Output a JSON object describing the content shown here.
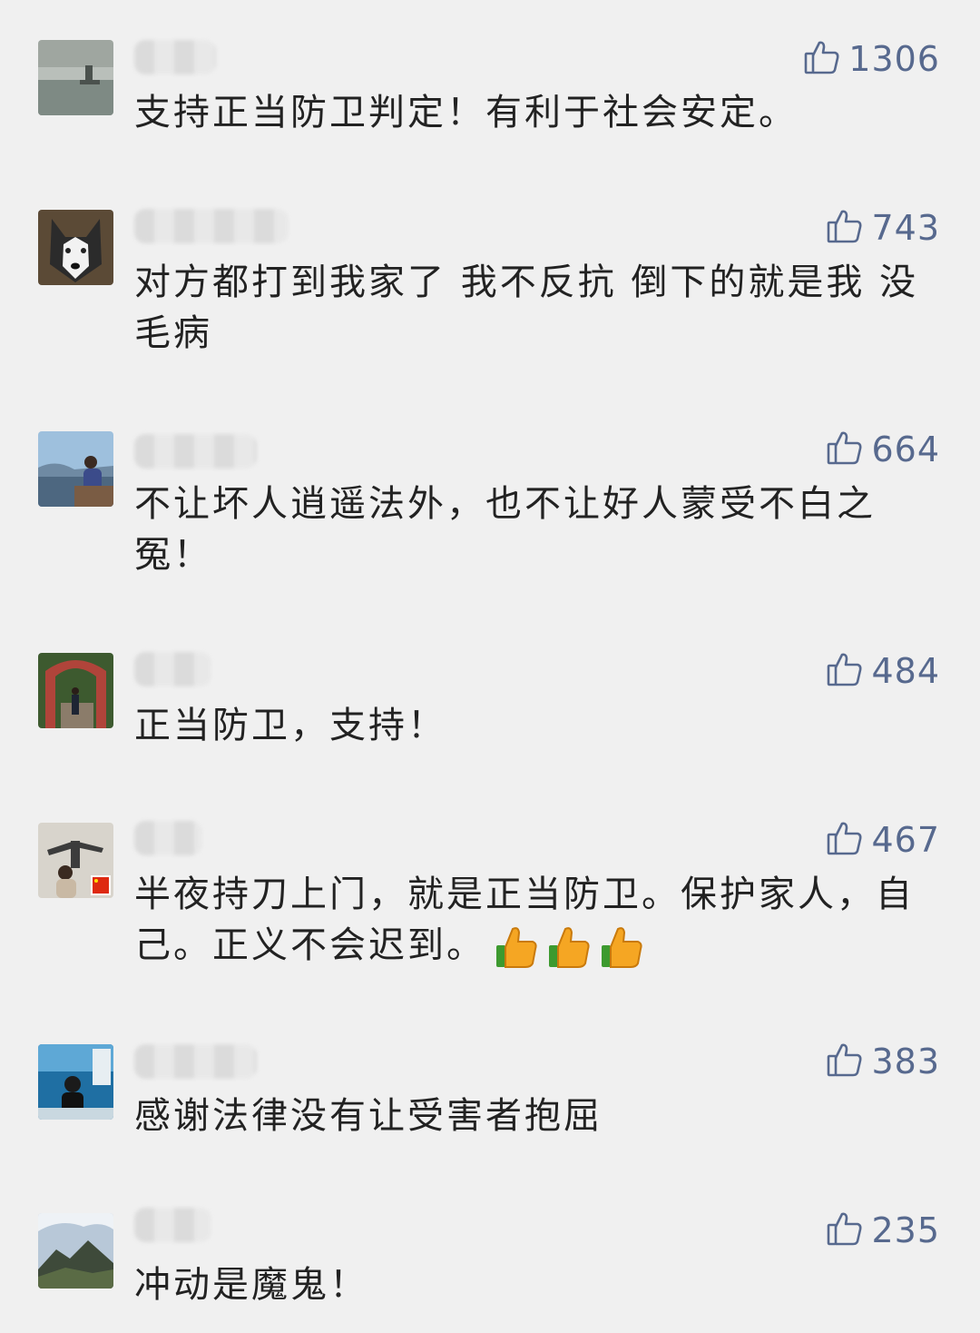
{
  "comments": [
    {
      "likes": "1306",
      "text": "支持正当防卫判定！有利于社会安定。",
      "avatar": "lake-boat"
    },
    {
      "likes": "743",
      "text": "对方都打到我家了  我不反抗 倒下的就是我 没毛病",
      "avatar": "husky-dog"
    },
    {
      "likes": "664",
      "text": "不让坏人逍遥法外，也不让好人蒙受不白之冤！",
      "avatar": "person-seaside"
    },
    {
      "likes": "484",
      "text": "正当防卫，支持！",
      "avatar": "person-garden-arch"
    },
    {
      "likes": "467",
      "text": "半夜持刀上门，就是正当防卫。保护家人，自己。正义不会迟到。",
      "avatar": "person-statue-flag",
      "emoji": [
        "thumbs-up-icon",
        "thumbs-up-icon",
        "thumbs-up-icon"
      ]
    },
    {
      "likes": "383",
      "text": "感谢法律没有让受害者抱屈",
      "avatar": "person-blue-sign"
    },
    {
      "likes": "235",
      "text": "冲动是魔鬼！",
      "avatar": "mountain-landscape"
    }
  ],
  "colors": {
    "accent": "#57698e",
    "background": "#f0f0f0",
    "text": "#222222"
  }
}
